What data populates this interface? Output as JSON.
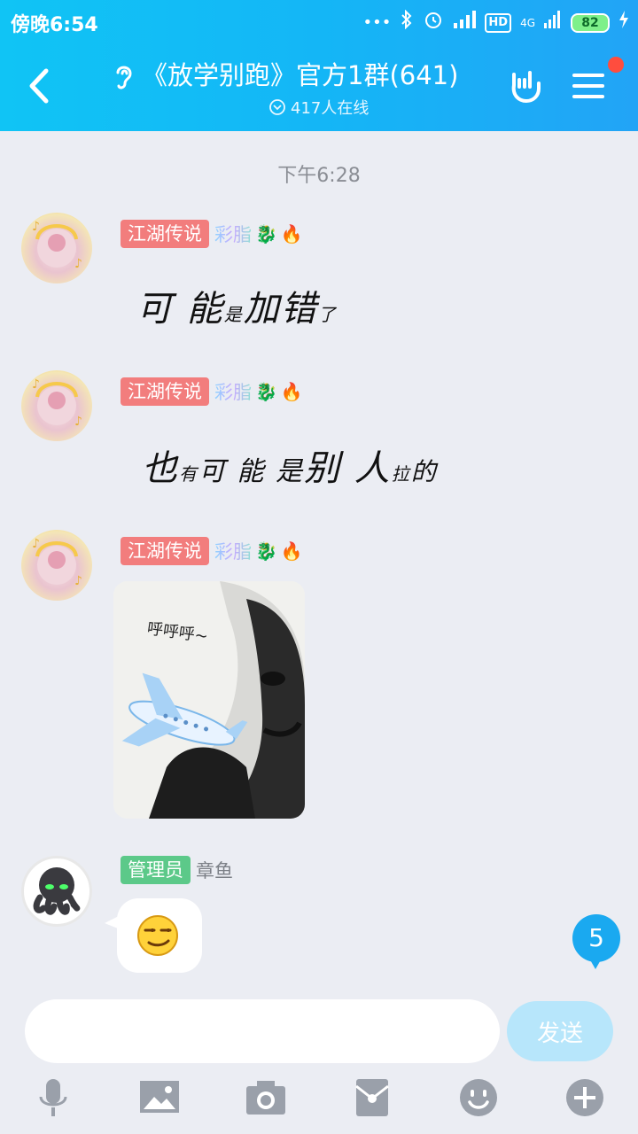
{
  "status_bar": {
    "time": "傍晚6:54",
    "dots": "•••",
    "hd": "HD",
    "net": "4G",
    "battery": "82"
  },
  "header": {
    "title": "《放学别跑》官方1群(641)",
    "online": "417人在线"
  },
  "chat": {
    "timestamp": "下午6:28",
    "messages": [
      {
        "badge": "江湖传说",
        "nick": "彩脂",
        "text_parts": [
          "可 能",
          "是",
          "加错",
          "了"
        ]
      },
      {
        "badge": "江湖传说",
        "nick": "彩脂",
        "text_parts": [
          "也",
          "有",
          "可 能 是",
          "别 人",
          "拉",
          "的"
        ]
      },
      {
        "badge": "江湖传说",
        "nick": "彩脂",
        "sticker_caption": "呼呼呼~"
      },
      {
        "badge": "管理员",
        "nick": "章鱼",
        "emoji": "smirk-face"
      }
    ],
    "unread_count": "5"
  },
  "input": {
    "placeholder": "",
    "send_label": "发送"
  },
  "colors": {
    "header_start": "#10c4f5",
    "header_end": "#22a4f6",
    "badge_red": "#f27d7d",
    "badge_green": "#5cc989",
    "unread": "#1aa9f0",
    "send_disabled": "#b7e6fb"
  },
  "icons": {
    "back": "back-arrow-icon",
    "ear": "ear-icon",
    "rock": "rock-hand-icon",
    "menu": "menu-icon",
    "toolbar": [
      "microphone-icon",
      "image-icon",
      "camera-icon",
      "red-packet-icon",
      "emoji-icon",
      "plus-icon"
    ]
  }
}
